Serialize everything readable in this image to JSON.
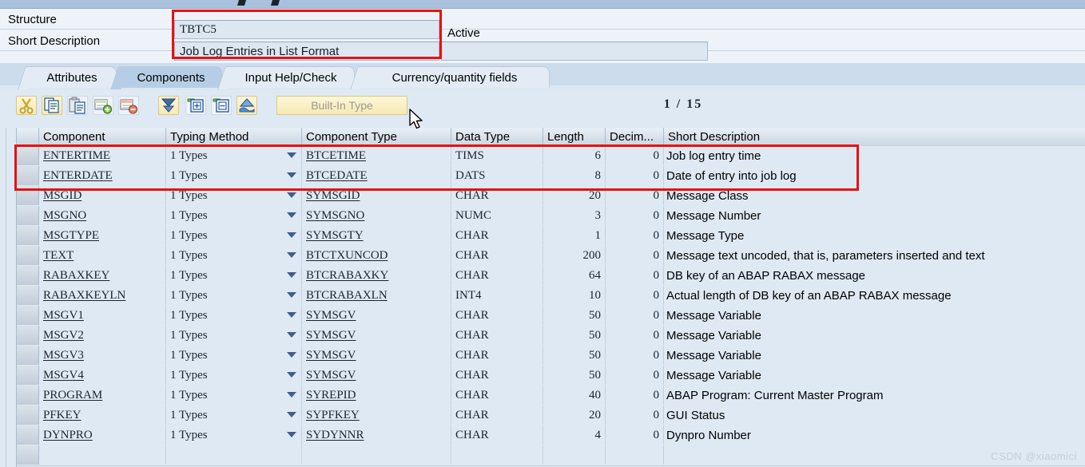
{
  "window": {
    "titlebar_visible_fragment": ""
  },
  "form": {
    "structure_label": "Structure",
    "structure_value": "TBTC5",
    "status_text": "Active",
    "short_description_label": "Short Description",
    "short_description_value": "Job Log Entries in List Format",
    "short_description_extra_value": ""
  },
  "tabs": [
    {
      "label": "Attributes",
      "active": false
    },
    {
      "label": "Components",
      "active": true
    },
    {
      "label": "Input Help/Check",
      "active": false
    },
    {
      "label": "Currency/quantity fields",
      "active": false
    }
  ],
  "toolbar": {
    "buttons": [
      {
        "name": "cut-icon"
      },
      {
        "name": "copy-icon"
      },
      {
        "name": "paste-icon"
      },
      {
        "name": "insert-row-icon"
      },
      {
        "name": "delete-row-icon"
      },
      {
        "name": "filter-icon"
      },
      {
        "name": "expand-icon"
      },
      {
        "name": "collapse-icon"
      },
      {
        "name": "predefined-type-icon"
      }
    ],
    "builtin_type_label": "Built-In Type",
    "counter": "1 / 15"
  },
  "grid": {
    "columns": [
      {
        "key": "component",
        "label": "Component"
      },
      {
        "key": "typing_method",
        "label": "Typing Method"
      },
      {
        "key": "component_type",
        "label": "Component Type"
      },
      {
        "key": "data_type",
        "label": "Data Type"
      },
      {
        "key": "length",
        "label": "Length"
      },
      {
        "key": "decimals",
        "label": "Decim..."
      },
      {
        "key": "short_description",
        "label": "Short Description"
      }
    ],
    "rows": [
      {
        "component": "ENTERTIME",
        "typing_method": "1 Types",
        "component_type": "BTCETIME",
        "data_type": "TIMS",
        "length": "6",
        "decimals": "0",
        "short_description": "Job log entry time"
      },
      {
        "component": "ENTERDATE",
        "typing_method": "1 Types",
        "component_type": "BTCEDATE",
        "data_type": "DATS",
        "length": "8",
        "decimals": "0",
        "short_description": "Date of entry into job log"
      },
      {
        "component": "MSGID",
        "typing_method": "1 Types",
        "component_type": "SYMSGID",
        "data_type": "CHAR",
        "length": "20",
        "decimals": "0",
        "short_description": "Message Class"
      },
      {
        "component": "MSGNO",
        "typing_method": "1 Types",
        "component_type": "SYMSGNO",
        "data_type": "NUMC",
        "length": "3",
        "decimals": "0",
        "short_description": "Message Number"
      },
      {
        "component": "MSGTYPE",
        "typing_method": "1 Types",
        "component_type": "SYMSGTY",
        "data_type": "CHAR",
        "length": "1",
        "decimals": "0",
        "short_description": "Message Type"
      },
      {
        "component": "TEXT",
        "typing_method": "1 Types",
        "component_type": "BTCTXUNCOD",
        "data_type": "CHAR",
        "length": "200",
        "decimals": "0",
        "short_description": "Message text uncoded, that is, parameters inserted and text"
      },
      {
        "component": "RABAXKEY",
        "typing_method": "1 Types",
        "component_type": "BTCRABAXKY",
        "data_type": "CHAR",
        "length": "64",
        "decimals": "0",
        "short_description": "DB key of an ABAP RABAX message"
      },
      {
        "component": "RABAXKEYLN",
        "typing_method": "1 Types",
        "component_type": "BTCRABAXLN",
        "data_type": "INT4",
        "length": "10",
        "decimals": "0",
        "short_description": "Actual length of DB key of an ABAP RABAX message"
      },
      {
        "component": "MSGV1",
        "typing_method": "1 Types",
        "component_type": "SYMSGV",
        "data_type": "CHAR",
        "length": "50",
        "decimals": "0",
        "short_description": "Message Variable"
      },
      {
        "component": "MSGV2",
        "typing_method": "1 Types",
        "component_type": "SYMSGV",
        "data_type": "CHAR",
        "length": "50",
        "decimals": "0",
        "short_description": "Message Variable"
      },
      {
        "component": "MSGV3",
        "typing_method": "1 Types",
        "component_type": "SYMSGV",
        "data_type": "CHAR",
        "length": "50",
        "decimals": "0",
        "short_description": "Message Variable"
      },
      {
        "component": "MSGV4",
        "typing_method": "1 Types",
        "component_type": "SYMSGV",
        "data_type": "CHAR",
        "length": "50",
        "decimals": "0",
        "short_description": "Message Variable"
      },
      {
        "component": "PROGRAM",
        "typing_method": "1 Types",
        "component_type": "SYREPID",
        "data_type": "CHAR",
        "length": "40",
        "decimals": "0",
        "short_description": "ABAP Program: Current Master Program"
      },
      {
        "component": "PFKEY",
        "typing_method": "1 Types",
        "component_type": "SYPFKEY",
        "data_type": "CHAR",
        "length": "20",
        "decimals": "0",
        "short_description": "GUI Status"
      },
      {
        "component": "DYNPRO",
        "typing_method": "1 Types",
        "component_type": "SYDYNNR",
        "data_type": "CHAR",
        "length": "4",
        "decimals": "0",
        "short_description": "Dynpro Number"
      },
      {
        "component": "",
        "typing_method": "",
        "component_type": "",
        "data_type": "",
        "length": "",
        "decimals": "",
        "short_description": ""
      }
    ]
  },
  "annotations": {
    "highlight_color": "#e8110f",
    "boxes": [
      {
        "name": "structure-fields-highlight"
      },
      {
        "name": "first-two-rows-highlight"
      }
    ]
  },
  "watermark": "CSDN @xiaomici",
  "colors": {
    "row_bg": "#dfe9f3",
    "header_grad_top": "#e9eff5",
    "header_grad_bottom": "#cbd6e1",
    "tab_active": "#b6cee5",
    "toolbar_button": "#f6e9b4",
    "accent_red": "#e8110f"
  }
}
